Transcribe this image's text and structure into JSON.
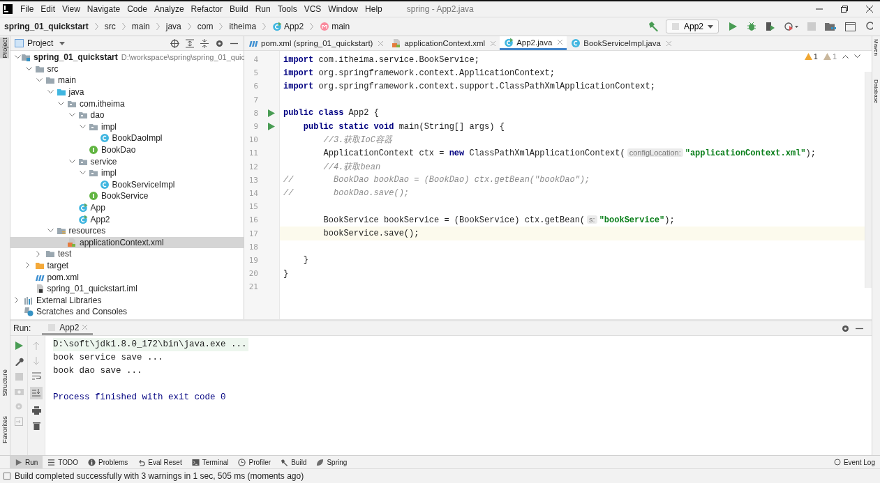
{
  "window": {
    "title": "spring - App2.java"
  },
  "menu": [
    "File",
    "Edit",
    "View",
    "Navigate",
    "Code",
    "Analyze",
    "Refactor",
    "Build",
    "Run",
    "Tools",
    "VCS",
    "Window",
    "Help"
  ],
  "breadcrumbs": [
    {
      "label": "spring_01_quickstart",
      "kind": "project"
    },
    {
      "label": "src",
      "kind": "plain"
    },
    {
      "label": "main",
      "kind": "plain"
    },
    {
      "label": "java",
      "kind": "plain"
    },
    {
      "label": "com",
      "kind": "plain"
    },
    {
      "label": "itheima",
      "kind": "plain"
    },
    {
      "label": "App2",
      "kind": "class"
    },
    {
      "label": "main",
      "kind": "method"
    }
  ],
  "run_config": "App2",
  "left_stripe": [
    "Project",
    "Structure",
    "Favorites"
  ],
  "right_stripe": [
    "Maven",
    "Database"
  ],
  "project_panel": {
    "title": "Project",
    "tree": [
      {
        "label": "spring_01_quickstart",
        "path": "D:\\workspace\\spring\\spring_01_quic",
        "kind": "module",
        "expanded": true,
        "selected": false,
        "children": [
          {
            "label": "src",
            "kind": "folder",
            "expanded": true,
            "selected": false,
            "children": [
              {
                "label": "main",
                "kind": "folder",
                "expanded": true,
                "selected": false,
                "children": [
                  {
                    "label": "java",
                    "kind": "source",
                    "expanded": true,
                    "selected": false,
                    "children": [
                      {
                        "label": "com.itheima",
                        "kind": "package",
                        "expanded": true,
                        "selected": false,
                        "children": [
                          {
                            "label": "dao",
                            "kind": "package",
                            "expanded": true,
                            "selected": false,
                            "children": [
                              {
                                "label": "impl",
                                "kind": "package",
                                "expanded": true,
                                "selected": false,
                                "children": [
                                  {
                                    "label": "BookDaoImpl",
                                    "kind": "class",
                                    "selected": false
                                  }
                                ]
                              },
                              {
                                "label": "BookDao",
                                "kind": "interface",
                                "selected": false
                              }
                            ]
                          },
                          {
                            "label": "service",
                            "kind": "package",
                            "expanded": true,
                            "selected": false,
                            "children": [
                              {
                                "label": "impl",
                                "kind": "package",
                                "expanded": true,
                                "selected": false,
                                "children": [
                                  {
                                    "label": "BookServiceImpl",
                                    "kind": "class",
                                    "selected": false
                                  }
                                ]
                              },
                              {
                                "label": "BookService",
                                "kind": "interface",
                                "selected": false
                              }
                            ]
                          },
                          {
                            "label": "App",
                            "kind": "main-class",
                            "selected": false
                          },
                          {
                            "label": "App2",
                            "kind": "main-class",
                            "selected": false
                          }
                        ]
                      }
                    ]
                  },
                  {
                    "label": "resources",
                    "kind": "resources",
                    "expanded": true,
                    "selected": false,
                    "children": [
                      {
                        "label": "applicationContext.xml",
                        "kind": "xml",
                        "selected": true
                      }
                    ]
                  }
                ]
              },
              {
                "label": "test",
                "kind": "folder",
                "expanded": false,
                "selected": false
              }
            ]
          },
          {
            "label": "target",
            "kind": "target",
            "expanded": false,
            "selected": false
          },
          {
            "label": "pom.xml",
            "kind": "maven",
            "selected": false
          },
          {
            "label": "spring_01_quickstart.iml",
            "kind": "iml",
            "selected": false
          }
        ]
      },
      {
        "label": "External Libraries",
        "kind": "libraries",
        "expanded": false,
        "selected": false
      },
      {
        "label": "Scratches and Consoles",
        "kind": "scratches",
        "selected": false
      }
    ]
  },
  "editor_tabs": [
    {
      "label": "pom.xml (spring_01_quickstart)",
      "kind": "maven",
      "selected": false
    },
    {
      "label": "applicationContext.xml",
      "kind": "xml",
      "selected": false
    },
    {
      "label": "App2.java",
      "kind": "main-class",
      "selected": true
    },
    {
      "label": "BookServiceImpl.java",
      "kind": "class",
      "selected": false
    }
  ],
  "inspections": [
    {
      "kind": "warning",
      "count": "1"
    },
    {
      "kind": "weak",
      "count": "1"
    }
  ],
  "code": [
    {
      "number": "4",
      "tokens": [
        {
          "kind": "kw",
          "text": "import"
        },
        {
          "kind": "plain",
          "text": " com.itheima.service.BookService;"
        }
      ]
    },
    {
      "number": "5",
      "tokens": [
        {
          "kind": "kw",
          "text": "import"
        },
        {
          "kind": "plain",
          "text": " org.springframework.context.ApplicationContext;"
        }
      ]
    },
    {
      "number": "6",
      "tokens": [
        {
          "kind": "kw",
          "text": "import"
        },
        {
          "kind": "plain",
          "text": " org.springframework.context.support.ClassPathXmlApplicationContext;"
        }
      ]
    },
    {
      "number": "7"
    },
    {
      "number": "8",
      "run": true,
      "tokens": [
        {
          "kind": "kw",
          "text": "public class"
        },
        {
          "kind": "plain",
          "text": " App2 {"
        }
      ]
    },
    {
      "number": "9",
      "run": true,
      "tokens": [
        {
          "kind": "kw",
          "text": "    public static void"
        },
        {
          "kind": "plain",
          "text": " main(String[] args) {"
        }
      ]
    },
    {
      "number": "10",
      "tokens": [
        {
          "kind": "comment",
          "text": "        //3.获取IoC容器"
        }
      ]
    },
    {
      "number": "11",
      "tokens": [
        {
          "kind": "plain",
          "text": "        ApplicationContext ctx = "
        },
        {
          "kind": "kw",
          "text": "new"
        },
        {
          "kind": "plain",
          "text": " ClassPathXmlApplicationContext("
        },
        {
          "kind": "hint",
          "text": "configLocation:"
        },
        {
          "kind": "str",
          "text": "\"applicationContext.xml\""
        },
        {
          "kind": "plain",
          "text": ");"
        }
      ]
    },
    {
      "number": "12",
      "tokens": [
        {
          "kind": "comment",
          "text": "        //4.获取bean"
        }
      ]
    },
    {
      "number": "13",
      "tokens": [
        {
          "kind": "comment",
          "text": "//        BookDao bookDao = (BookDao) ctx.getBean(\"bookDao\");"
        }
      ]
    },
    {
      "number": "14",
      "tokens": [
        {
          "kind": "comment",
          "text": "//        bookDao.save();"
        }
      ]
    },
    {
      "number": "15"
    },
    {
      "number": "16",
      "tokens": [
        {
          "kind": "plain",
          "text": "        BookService bookService = (BookService) ctx.getBean("
        },
        {
          "kind": "hint",
          "text": "s:"
        },
        {
          "kind": "str",
          "text": "\"bookService\""
        },
        {
          "kind": "plain",
          "text": ");"
        }
      ]
    },
    {
      "number": "17",
      "current": true,
      "tokens": [
        {
          "kind": "plain",
          "text": "        bookService.save();"
        }
      ]
    },
    {
      "number": "18"
    },
    {
      "number": "19",
      "tokens": [
        {
          "kind": "plain",
          "text": "    }"
        }
      ]
    },
    {
      "number": "20",
      "tokens": [
        {
          "kind": "plain",
          "text": "}"
        }
      ]
    },
    {
      "number": "21"
    }
  ],
  "run_panel": {
    "label": "Run:",
    "tab": "App2",
    "console": [
      {
        "kind": "command",
        "text": "D:\\soft\\jdk1.8.0_172\\bin\\java.exe ..."
      },
      {
        "kind": "output",
        "text": "book service save ..."
      },
      {
        "kind": "output",
        "text": "book dao save ..."
      },
      {
        "kind": "exit",
        "text": "Process finished with exit code 0"
      }
    ]
  },
  "tool_tabs": [
    {
      "label": "Run",
      "selected": true
    },
    {
      "label": "TODO",
      "selected": false
    },
    {
      "label": "Problems",
      "selected": false
    },
    {
      "label": "Eval Reset",
      "selected": false
    },
    {
      "label": "Terminal",
      "selected": false
    },
    {
      "label": "Profiler",
      "selected": false
    },
    {
      "label": "Build",
      "selected": false
    },
    {
      "label": "Spring",
      "selected": false
    }
  ],
  "event_log": "Event Log",
  "status_bar": "Build completed successfully with 3 warnings in 1 sec, 505 ms (moments ago)"
}
